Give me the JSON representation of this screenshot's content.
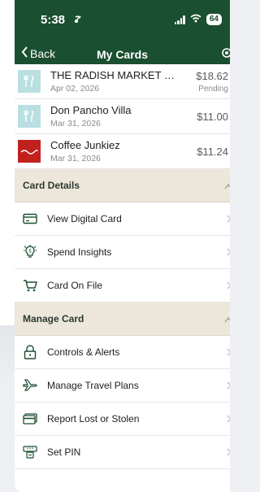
{
  "status_bar": {
    "time": "5:38",
    "battery": "64"
  },
  "nav": {
    "back_label": "Back",
    "title": "My Cards"
  },
  "transactions": [
    {
      "merchant": "THE RADISH MARKET & CA...",
      "date": "Apr 02, 2026",
      "amount": "$18.62",
      "status": "Pending",
      "logo": "utensils-icon"
    },
    {
      "merchant": "Don Pancho Villa",
      "date": "Mar 31, 2026",
      "amount": "$11.00",
      "status": "",
      "logo": "utensils-icon"
    },
    {
      "merchant": "Coffee Junkiez",
      "date": "Mar 31, 2026",
      "amount": "$11.24",
      "status": "",
      "logo": "coffee-junkiez-logo"
    }
  ],
  "card_details": {
    "header": "Card Details",
    "items": [
      {
        "label": "View Digital Card",
        "icon": "card-icon"
      },
      {
        "label": "Spend Insights",
        "icon": "lightbulb-icon"
      },
      {
        "label": "Card On File",
        "icon": "cart-icon"
      }
    ]
  },
  "manage_card": {
    "header": "Manage Card",
    "items": [
      {
        "label": "Controls & Alerts",
        "icon": "lock-icon"
      },
      {
        "label": "Manage Travel Plans",
        "icon": "airplane-icon"
      },
      {
        "label": "Report Lost or Stolen",
        "icon": "card-report-icon"
      },
      {
        "label": "Set PIN",
        "icon": "pin-icon"
      }
    ]
  },
  "colors": {
    "header_green": "#1b4f31",
    "section_beige": "#ede6da",
    "icon_green": "#1b4f31"
  }
}
